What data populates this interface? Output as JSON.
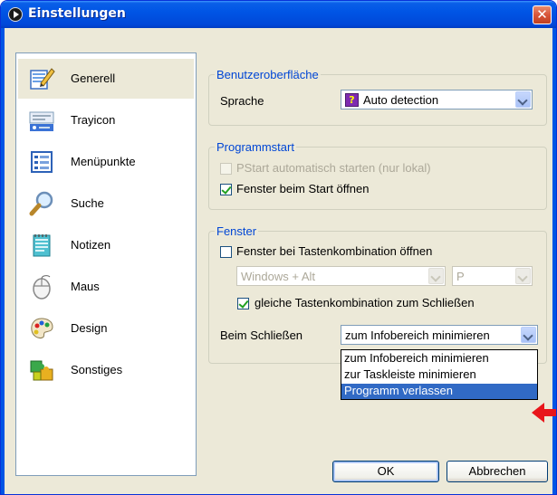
{
  "window": {
    "title": "Einstellungen",
    "close_glyph": "✕"
  },
  "sidebar": {
    "items": [
      {
        "label": "Generell",
        "icon": "pencil-document-icon"
      },
      {
        "label": "Trayicon",
        "icon": "tray-icon"
      },
      {
        "label": "Menüpunkte",
        "icon": "menu-list-icon"
      },
      {
        "label": "Suche",
        "icon": "magnifier-icon"
      },
      {
        "label": "Notizen",
        "icon": "notepad-icon"
      },
      {
        "label": "Maus",
        "icon": "mouse-icon"
      },
      {
        "label": "Design",
        "icon": "palette-icon"
      },
      {
        "label": "Sonstiges",
        "icon": "puzzle-icon"
      }
    ],
    "selected": "Generell"
  },
  "ui": {
    "title": "Benutzeroberfläche",
    "language_label": "Sprache",
    "language_value": "Auto detection"
  },
  "startup": {
    "title": "Programmstart",
    "autostart_label": "PStart automatisch starten (nur lokal)",
    "autostart_checked": false,
    "autostart_disabled": true,
    "open_window_label": "Fenster beim Start öffnen",
    "open_window_checked": true
  },
  "window_group": {
    "title": "Fenster",
    "hotkey_label": "Fenster bei Tastenkombination öffnen",
    "hotkey_checked": false,
    "modifier_value": "Windows + Alt",
    "key_value": "P",
    "same_hotkey_label": "gleiche Tastenkombination zum Schließen",
    "same_hotkey_checked": true,
    "on_close_label": "Beim Schließen",
    "on_close_value": "zum Infobereich minimieren",
    "on_close_options": [
      "zum Infobereich minimieren",
      "zur Taskleiste minimieren",
      "Programm verlassen"
    ],
    "highlighted_option": "Programm verlassen"
  },
  "buttons": {
    "ok": "OK",
    "cancel": "Abbrechen"
  },
  "colors": {
    "accent": "#0046d5",
    "highlight": "#316ac5",
    "annotation_arrow": "#e8161b"
  }
}
